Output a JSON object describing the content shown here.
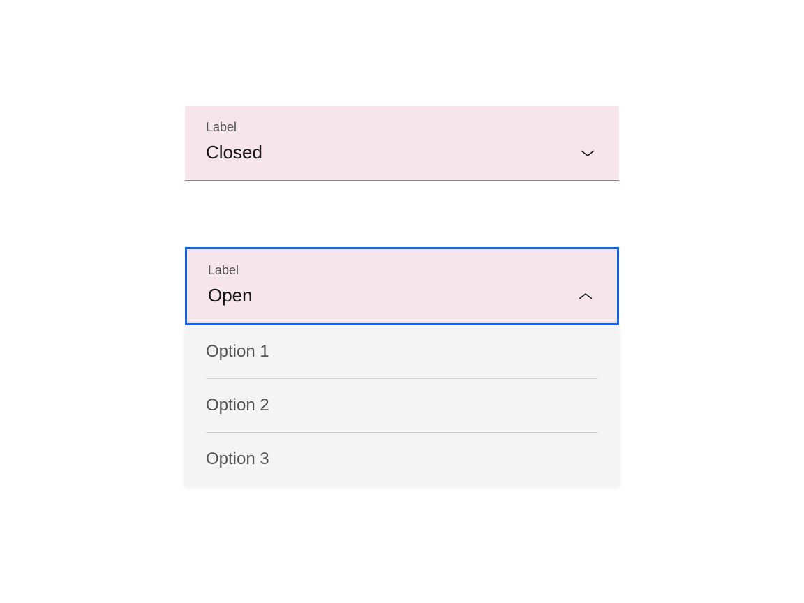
{
  "closed_dropdown": {
    "label": "Label",
    "value": "Closed"
  },
  "open_dropdown": {
    "label": "Label",
    "value": "Open",
    "options": [
      "Option 1",
      "Option 2",
      "Option 3"
    ]
  }
}
